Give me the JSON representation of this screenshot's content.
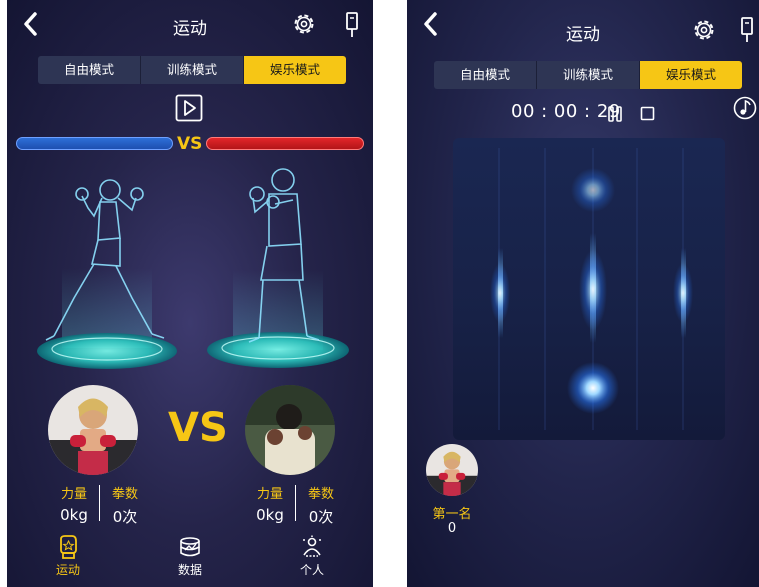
{
  "left_screen": {
    "title": "运动",
    "modes": [
      {
        "label": "自由模式",
        "active": false
      },
      {
        "label": "训练模式",
        "active": false
      },
      {
        "label": "娱乐模式",
        "active": true
      }
    ],
    "vs_small": "VS",
    "vs_big": "VS",
    "player1": {
      "strength_label": "力量",
      "strength_value": "0kg",
      "punches_label": "拳数",
      "punches_value": "0次"
    },
    "player2": {
      "strength_label": "力量",
      "strength_value": "0kg",
      "punches_label": "拳数",
      "punches_value": "0次"
    },
    "nav": [
      {
        "label": "运动",
        "icon": "boxing-glove-icon",
        "active": true
      },
      {
        "label": "数据",
        "icon": "data-icon",
        "active": false
      },
      {
        "label": "个人",
        "icon": "person-icon",
        "active": false
      }
    ]
  },
  "right_screen": {
    "title": "运动",
    "modes": [
      {
        "label": "自由模式",
        "active": false
      },
      {
        "label": "训练模式",
        "active": false
      },
      {
        "label": "娱乐模式",
        "active": true
      }
    ],
    "timer": "00 : 00 : 29",
    "ranking": {
      "label": "第一名",
      "score": "0"
    }
  },
  "colors": {
    "accent": "#f6c615",
    "blue_bar": "#2d6fd8",
    "red_bar": "#e3262a",
    "inactive_tab": "#2e3554"
  }
}
